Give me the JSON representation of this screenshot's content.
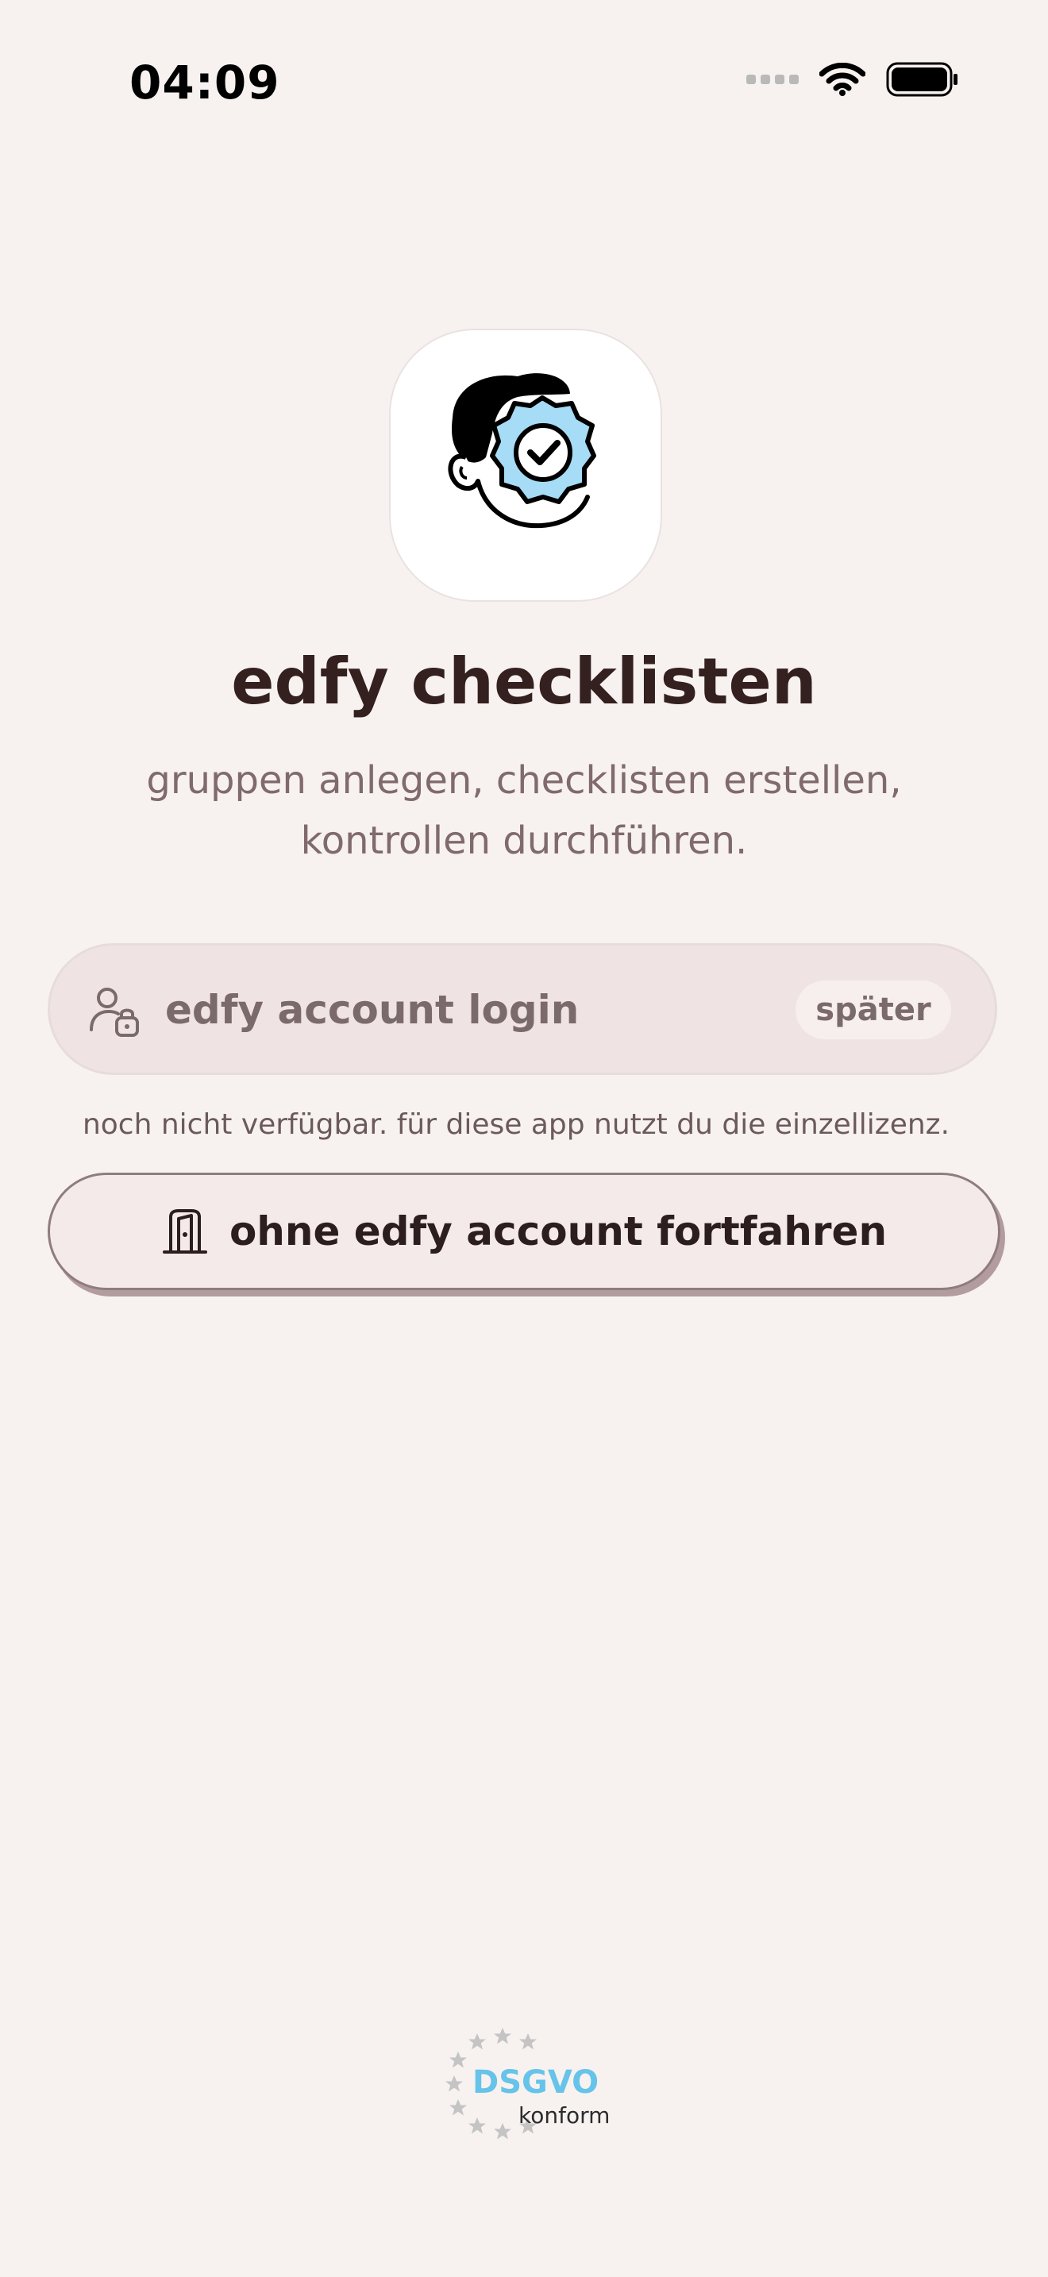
{
  "status_bar": {
    "time": "04:09"
  },
  "app": {
    "title": "edfy checklisten",
    "subtitle": "gruppen anlegen, checklisten erstellen, kontrollen durchführen."
  },
  "login": {
    "label": "edfy account login",
    "later_label": "später",
    "note": "noch nicht verfügbar. für diese app nutzt du die einzellizenz."
  },
  "continue_button": {
    "label": "ohne edfy account fortfahren"
  },
  "badge": {
    "title": "DSGVO",
    "subtitle": "konform"
  },
  "colors": {
    "background": "#f7f2f0",
    "text_primary": "#2c1e1f",
    "text_muted": "#806a6c",
    "badge_blue": "#66c3e9",
    "badge_star": "#c4c4c4",
    "icon_badge": "#a6dcf5"
  },
  "icons": [
    "wifi-icon",
    "battery-icon",
    "user-lock-icon",
    "door-icon",
    "verified-person-icon",
    "star-icon"
  ]
}
